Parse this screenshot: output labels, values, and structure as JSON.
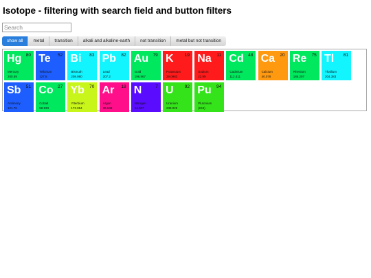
{
  "page": {
    "title": "Isotope - filtering with search field and button filters"
  },
  "search": {
    "placeholder": "Search",
    "value": ""
  },
  "filters": [
    {
      "label": "show all",
      "active": true
    },
    {
      "label": "metal",
      "active": false
    },
    {
      "label": "transition",
      "active": false
    },
    {
      "label": "alkali and alkaline-earth",
      "active": false
    },
    {
      "label": "not transition",
      "active": false
    },
    {
      "label": "metal but not transition",
      "active": false
    }
  ],
  "elements": [
    {
      "symbol": "Hg",
      "number": "80",
      "name": "Mercury",
      "weight": "200.59",
      "color": "#00e85e"
    },
    {
      "symbol": "Te",
      "number": "52",
      "name": "Tellurium",
      "weight": "127.6",
      "color": "#1e5eff"
    },
    {
      "symbol": "Bi",
      "number": "83",
      "name": "Bismuth",
      "weight": "208.980",
      "color": "#12f5ff"
    },
    {
      "symbol": "Pb",
      "number": "82",
      "name": "Lead",
      "weight": "207.2",
      "color": "#12f5ff"
    },
    {
      "symbol": "Au",
      "number": "79",
      "name": "Gold",
      "weight": "196.967",
      "color": "#00e85e"
    },
    {
      "symbol": "K",
      "number": "19",
      "name": "Potassium",
      "weight": "39.0983",
      "color": "#ff1b1b"
    },
    {
      "symbol": "Na",
      "number": "11",
      "name": "Sodium",
      "weight": "22.99",
      "color": "#ff1b1b"
    },
    {
      "symbol": "Cd",
      "number": "48",
      "name": "Cadmium",
      "weight": "112.411",
      "color": "#00e85e"
    },
    {
      "symbol": "Ca",
      "number": "20",
      "name": "Calcium",
      "weight": "40.078",
      "color": "#ff9a10"
    },
    {
      "symbol": "Re",
      "number": "75",
      "name": "Rhenium",
      "weight": "186.207",
      "color": "#00e85e"
    },
    {
      "symbol": "Tl",
      "number": "81",
      "name": "Thallium",
      "weight": "204.383",
      "color": "#12f5ff"
    },
    {
      "symbol": "Sb",
      "number": "51",
      "name": "Antimony",
      "weight": "121.76",
      "color": "#1e5eff"
    },
    {
      "symbol": "Co",
      "number": "27",
      "name": "Cobalt",
      "weight": "58.933",
      "color": "#00e85e"
    },
    {
      "symbol": "Yb",
      "number": "70",
      "name": "Ytterbium",
      "weight": "173.054",
      "color": "#c8f51a"
    },
    {
      "symbol": "Ar",
      "number": "18",
      "name": "Argon",
      "weight": "39.948",
      "color": "#ff0f8a"
    },
    {
      "symbol": "N",
      "number": "7",
      "name": "Nitrogen",
      "weight": "14.007",
      "color": "#5a0cff"
    },
    {
      "symbol": "U",
      "number": "92",
      "name": "Uranium",
      "weight": "238.029",
      "color": "#34e31a"
    },
    {
      "symbol": "Pu",
      "number": "94",
      "name": "Plutonium",
      "weight": "(244)",
      "color": "#34e31a"
    }
  ]
}
